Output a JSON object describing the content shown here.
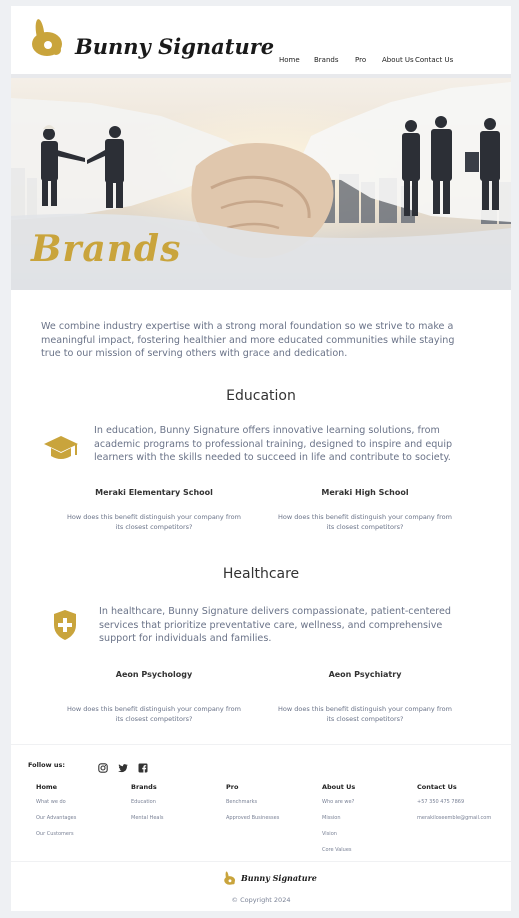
{
  "brand": {
    "name": "Bunny Signature",
    "accent": "#c9a43c"
  },
  "nav": {
    "items": [
      "Home",
      "Brands",
      "Pro",
      "About Us",
      "Contact Us"
    ]
  },
  "hero": {
    "title": "Brands"
  },
  "intro": "We combine industry expertise with a strong moral foundation so we strive to make a meaningful impact, fostering healthier and more educated communities while staying true to our mission of serving others with grace and dedication.",
  "sections": [
    {
      "title": "Education",
      "icon": "graduation-cap-icon",
      "text": "In education, Bunny Signature offers innovative learning solutions, from academic programs to professional training, designed to inspire and equip learners with the skills needed to succeed in life and contribute to society.",
      "items": [
        {
          "title": "Meraki Elementary School",
          "desc": "How does this benefit distinguish your company from its closest competitors?"
        },
        {
          "title": "Meraki High School",
          "desc": "How does this benefit distinguish your company from its closest competitors?"
        }
      ]
    },
    {
      "title": "Healthcare",
      "icon": "shield-plus-icon",
      "text": "In healthcare, Bunny Signature delivers compassionate, patient-centered services that prioritize preventative care, wellness, and comprehensive support for individuals and families.",
      "items": [
        {
          "title": "Aeon Psychology",
          "desc": "How does this benefit distinguish your company from its closest competitors?"
        },
        {
          "title": "Aeon Psychiatry",
          "desc": "How does this benefit distinguish your company from its closest competitors?"
        }
      ]
    }
  ],
  "footer": {
    "follow_label": "Follow us:",
    "social": [
      "instagram-icon",
      "twitter-icon",
      "facebook-icon"
    ],
    "columns": [
      {
        "heading": "Home",
        "links": [
          "What we do",
          "Our Advantages",
          "Our Customers"
        ]
      },
      {
        "heading": "Brands",
        "links": [
          "Education",
          "Mental Heals"
        ]
      },
      {
        "heading": "Pro",
        "links": [
          "Benchmarks",
          "Approved Businesses"
        ]
      },
      {
        "heading": "About Us",
        "links": [
          "Who are we?",
          "Mission",
          "Vision",
          "Core Values"
        ]
      },
      {
        "heading": "Contact Us",
        "links": [
          "+57 350 475 7869",
          "merakiloseemble@gmail.com"
        ]
      }
    ],
    "copyright": "© Copyright 2024"
  }
}
